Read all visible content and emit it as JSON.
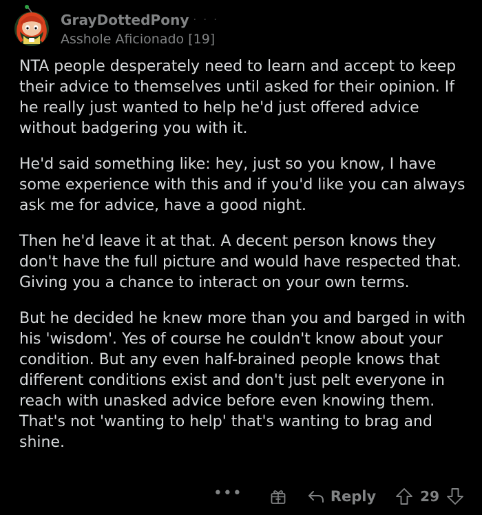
{
  "comment": {
    "author": {
      "username": "GrayDottedPony",
      "meta_dots": "· · ·",
      "flair": "Asshole Aficionado [19]",
      "avatar_icon": "snoo-avatar-icon"
    },
    "paragraphs": [
      "NTA people desperately need to learn and accept to keep their advice to themselves until asked for their opinion. If he really just wanted to help he'd just offered advice without badgering you with it.",
      "He'd said something like: hey, just so you know, I have some experience with this and if you'd like you can always ask me for advice, have a good night.",
      "Then he'd leave it at that. A decent person knows they don't have the full picture and would have respected that. Giving you a chance to interact on your own terms.",
      "But he decided he knew more than you and barged in with his 'wisdom'. Yes of course he couldn't know about your condition. But any even half-brained people knows that different conditions exist and don't just pelt everyone in reach with unasked advice before even knowing them. That's not 'wanting to help' that's wanting to brag and shine."
    ],
    "actions": {
      "more_label": "•••",
      "award_icon": "award-icon",
      "reply_icon": "reply-arrow-icon",
      "reply_label": "Reply",
      "upvote_icon": "upvote-arrow-icon",
      "score": "29",
      "downvote_icon": "downvote-arrow-icon"
    }
  },
  "colors": {
    "background": "#000000",
    "body_text": "#d7dadc",
    "meta_text": "#818384",
    "avatar_bg": "#1f3d22",
    "avatar_hair": "#d9411e"
  }
}
